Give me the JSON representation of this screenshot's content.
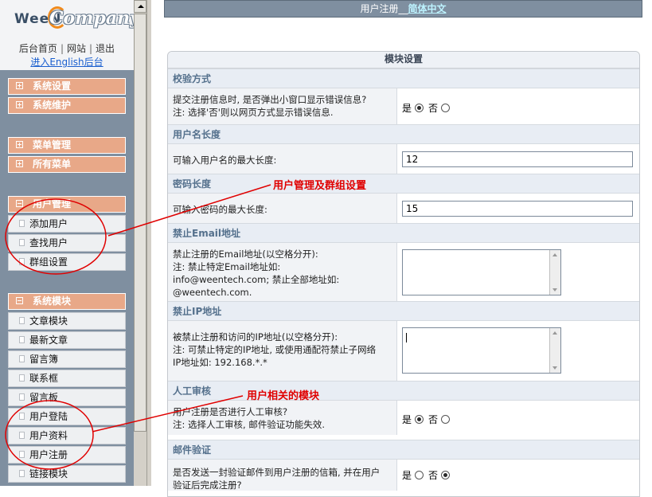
{
  "sidebar": {
    "logo_left": "WeeN",
    "logo_right": "Company",
    "links": [
      "后台首页",
      "网站",
      "退出"
    ],
    "english_link": "进入English后台",
    "groups": [
      {
        "label": "系统设置",
        "expanded": false
      },
      {
        "label": "系统维护",
        "expanded": false
      },
      {
        "label": "菜单管理",
        "expanded": false
      },
      {
        "label": "所有菜单",
        "expanded": false
      },
      {
        "label": "用户管理",
        "expanded": true,
        "items": [
          "添加用户",
          "查找用户",
          "群组设置"
        ]
      },
      {
        "label": "系统模块",
        "expanded": true,
        "items": [
          "文章模块",
          "最新文章",
          "留言簿",
          "联系框",
          "留言板",
          "用户登陆",
          "用户资料",
          "用户注册",
          "链接模块"
        ]
      }
    ]
  },
  "header": {
    "title_prefix": "用户注册__",
    "lang_link": "简体中文"
  },
  "panel": {
    "title": "模块设置",
    "sections": [
      {
        "head": "校验方式",
        "label_lines": [
          "提交注册信息时, 是否弹出小窗口显示错误信息?",
          "注: 选择'否'则以网页方式显示错误信息."
        ],
        "yes": "是",
        "no": "否",
        "selected": "yes"
      },
      {
        "head": "用户名长度",
        "label_lines": [
          "可输入用户名的最大长度:"
        ],
        "value": "12"
      },
      {
        "head": "密码长度",
        "label_lines": [
          "可输入密码的最大长度:"
        ],
        "value": "15"
      },
      {
        "head": "禁止Email地址",
        "label_lines": [
          "禁止注册的Email地址(以空格分开):",
          "注: 禁止特定Email地址如:",
          "info@weentech.com; 禁止全部地址如:",
          "@weentech.com."
        ]
      },
      {
        "head": "禁止IP地址",
        "label_lines": [
          "被禁止注册和访问的IP地址(以空格分开):",
          "注: 可禁止特定的IP地址, 或使用通配符禁止子网络",
          "IP地址如: 192.168.*.*"
        ]
      },
      {
        "head": "人工审核",
        "label_lines": [
          "用户注册是否进行人工审核?",
          "注: 选择人工审核, 邮件验证功能失效."
        ],
        "yes": "是",
        "no": "否",
        "selected": "yes"
      },
      {
        "head": "邮件验证",
        "label_lines": [
          "是否发送一封验证邮件到用户注册的信箱, 并在用户",
          "验证后完成注册?"
        ],
        "yes": "是",
        "no": "否",
        "selected": "no"
      }
    ]
  },
  "annotations": {
    "user_mgmt": "用户管理及群组设置",
    "user_modules": "用户相关的模块",
    "color": "#e00000"
  }
}
